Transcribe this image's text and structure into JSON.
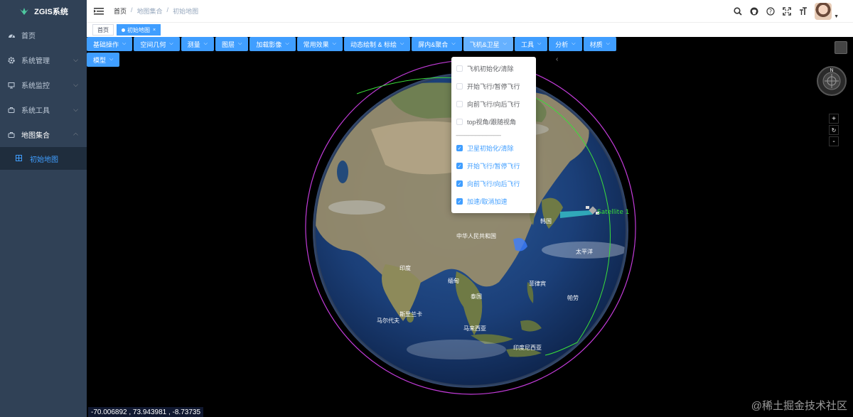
{
  "app": {
    "logo_text": "ZGIS系统"
  },
  "sidebar": {
    "items": [
      {
        "label": "首页",
        "icon": "dashboard-icon"
      },
      {
        "label": "系统管理",
        "icon": "gear-icon"
      },
      {
        "label": "系统监控",
        "icon": "monitor-icon"
      },
      {
        "label": "系统工具",
        "icon": "tool-icon"
      },
      {
        "label": "地图集合",
        "icon": "map-icon"
      }
    ],
    "sub_item": "初始地图",
    "colors": {
      "bg": "#304156",
      "sub_bg": "#1f2d3d",
      "active": "#409eff"
    }
  },
  "breadcrumb": {
    "home": "首页",
    "sep1": "/",
    "level2": "地图集合",
    "sep2": "/",
    "level3": "初始地图"
  },
  "tags": {
    "home": "首页",
    "active": "初始地图",
    "close": "×"
  },
  "toolbar": {
    "buttons": [
      "基础操作",
      "空间几何",
      "测量",
      "图层",
      "加载影像",
      "常用效果",
      "动态绘制 & 标绘",
      "屏内&聚合",
      "飞机&卫星",
      "工具",
      "分析",
      "材质",
      "模型"
    ],
    "caret": "⌵"
  },
  "dropdown": {
    "items": [
      {
        "label": "飞机初始化/清除",
        "checked": false
      },
      {
        "label": "开始飞行/暂停飞行",
        "checked": false
      },
      {
        "label": "向前飞行/向后飞行",
        "checked": false
      },
      {
        "label": "top视角/跟随视角",
        "checked": false
      },
      {
        "label": "卫星初始化/清除",
        "checked": true
      },
      {
        "label": "开始飞行/暂停飞行",
        "checked": true
      },
      {
        "label": "向前飞行/向后飞行",
        "checked": true
      },
      {
        "label": "加速/取消加速",
        "checked": true
      }
    ],
    "separator": "--------------------------------------"
  },
  "map": {
    "labels": {
      "china": "中华人民共和国",
      "india": "印度",
      "myanmar": "缅甸",
      "thailand": "泰国",
      "sri_lanka": "斯里兰卡",
      "maldives": "马尔代夫",
      "malaysia": "马来西亚",
      "philippines": "菲律宾",
      "korea": "韩国",
      "pacific": "太平洋",
      "palau": "帕劳",
      "indonesia": "印度尼西亚"
    },
    "satellite_label": "Satellite 1",
    "compass_n": "N",
    "zoom_in": "+",
    "zoom_reset": "↻",
    "zoom_out": "-",
    "coords": "-70.006892 ,  73.943981 ,  -8.73735"
  },
  "watermark": "@稀土掘金技术社区"
}
